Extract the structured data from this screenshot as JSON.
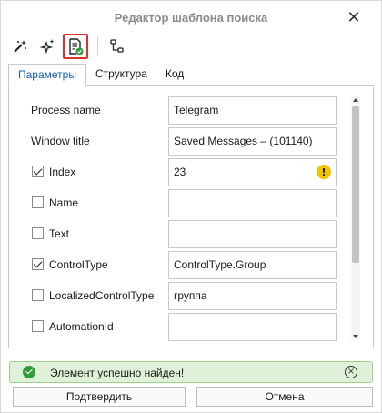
{
  "window": {
    "title": "Редактор шаблона поиска",
    "close_glyph": "✕"
  },
  "toolbar": {
    "buttons": [
      {
        "icon": "magic-wand-icon"
      },
      {
        "icon": "sparkles-icon"
      },
      {
        "icon": "document-check-icon",
        "active": true
      },
      {
        "icon": "tree-hierarchy-icon"
      }
    ]
  },
  "tabs": [
    {
      "label": "Параметры",
      "active": true
    },
    {
      "label": "Структура"
    },
    {
      "label": "Код"
    }
  ],
  "params": {
    "process_name": {
      "label": "Process name",
      "value": "Telegram"
    },
    "window_title": {
      "label": "Window title",
      "value": "Saved Messages – (101140)"
    },
    "index": {
      "label": "Index",
      "checked": true,
      "value": "23",
      "warning": "!"
    },
    "name": {
      "label": "Name",
      "checked": false,
      "value": ""
    },
    "text": {
      "label": "Text",
      "checked": false,
      "value": ""
    },
    "control_type": {
      "label": "ControlType",
      "checked": true,
      "value": "ControlType.Group"
    },
    "localized_control_type": {
      "label": "LocalizedControlType",
      "checked": false,
      "value": "группа"
    },
    "automation_id": {
      "label": "AutomationId",
      "checked": false,
      "value": ""
    }
  },
  "status": {
    "text": "Элемент успешно найден!",
    "close_glyph": "×",
    "color": "#dff1d8"
  },
  "buttons": {
    "confirm": "Подтвердить",
    "cancel": "Отмена"
  },
  "colors": {
    "accent": "#1a5fb4",
    "highlight": "#d9342b",
    "success": "#2e9e3c",
    "warning": "#f2c300"
  }
}
